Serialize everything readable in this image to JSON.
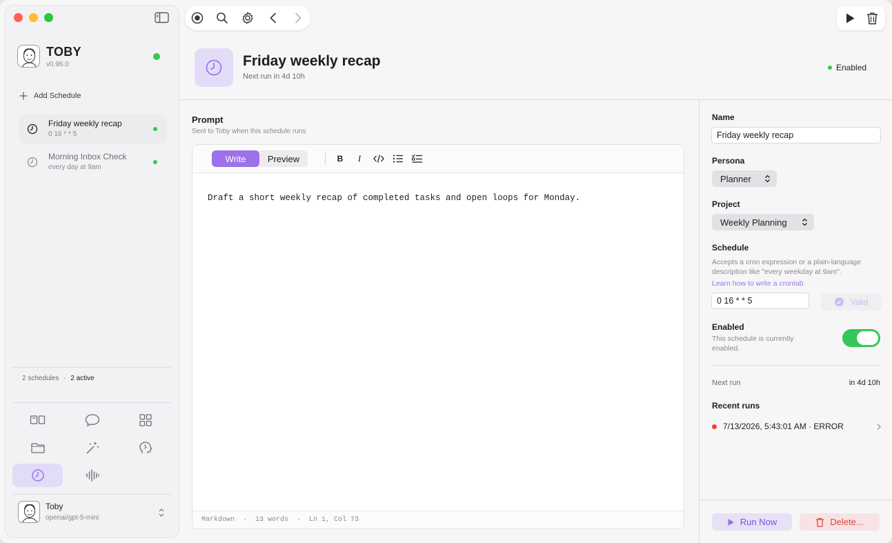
{
  "app": {
    "name": "TOBY",
    "version": "v0.96.0"
  },
  "sidebar": {
    "add_label": "Add Schedule",
    "schedules": [
      {
        "title": "Friday weekly recap",
        "subtitle": "0 16 * * 5"
      },
      {
        "title": "Morning Inbox Check",
        "subtitle": "every day at 9am"
      }
    ],
    "stats": {
      "count": "2 schedules",
      "separator": "·",
      "active": "2 active"
    },
    "nav_icons": [
      "layout-icon",
      "chat-icon",
      "grid-icon",
      "folder-icon",
      "magic-wand-icon",
      "brain-icon",
      "clock-icon",
      "waveform-icon"
    ],
    "user": {
      "name": "Toby",
      "model": "openai/gpt-5-mini"
    }
  },
  "header": {
    "title": "Friday weekly recap",
    "subtitle": "Next run in 4d 10h",
    "status": "Enabled"
  },
  "editor": {
    "label": "Prompt",
    "hint": "Sent to Toby when this schedule runs",
    "tab_write": "Write",
    "tab_preview": "Preview",
    "bold": "B",
    "italic": "I",
    "content": "Draft a short weekly recap of completed tasks and open loops for Monday.",
    "footer": "Markdown  ·  13 words  ·  Ln 1, Col 73"
  },
  "inspector": {
    "name_label": "Name",
    "name_value": "Friday weekly recap",
    "persona_label": "Persona",
    "persona_value": "Planner",
    "project_label": "Project",
    "project_value": "Weekly Planning",
    "schedule_label": "Schedule",
    "schedule_help": "Accepts a cron expression or a plain-language description like \"every weekday at 9am\".",
    "schedule_link": "Learn how to write a crontab",
    "schedule_value": "0 16 * * 5",
    "valid_label": "Valid",
    "enabled_label": "Enabled",
    "enabled_help": "This schedule is currently enabled.",
    "enabled": true,
    "next_run_label": "Next run",
    "next_run_value": "in 4d 10h",
    "recent_label": "Recent runs",
    "recent_runs": [
      {
        "text": "7/13/2026, 5:43:01 AM · ERROR",
        "status": "error"
      }
    ],
    "run_now": "Run Now",
    "delete": "Delete..."
  },
  "colors": {
    "accent": "#9b72e8",
    "accent_bg": "#e3dcf8",
    "success": "#34c759",
    "error": "#ff3b30"
  }
}
